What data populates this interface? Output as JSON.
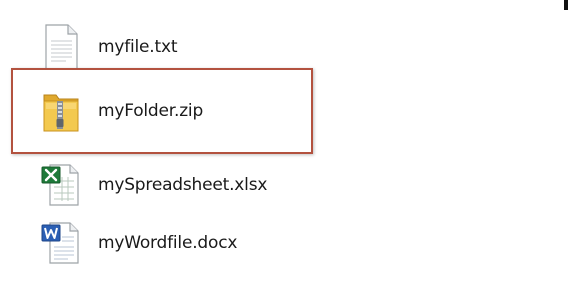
{
  "files": [
    {
      "name": "myfile.txt",
      "icon": "text-file-icon"
    },
    {
      "name": "myFolder.zip",
      "icon": "zip-folder-icon",
      "highlighted": true
    },
    {
      "name": "mySpreadsheet.xlsx",
      "icon": "excel-file-icon"
    },
    {
      "name": "myWordfile.docx",
      "icon": "word-file-icon"
    }
  ],
  "colors": {
    "highlight_border": "#b3523f",
    "excel_green": "#1e7a3a",
    "word_blue": "#2b5fb4",
    "folder_yellow": "#f3c94f"
  }
}
